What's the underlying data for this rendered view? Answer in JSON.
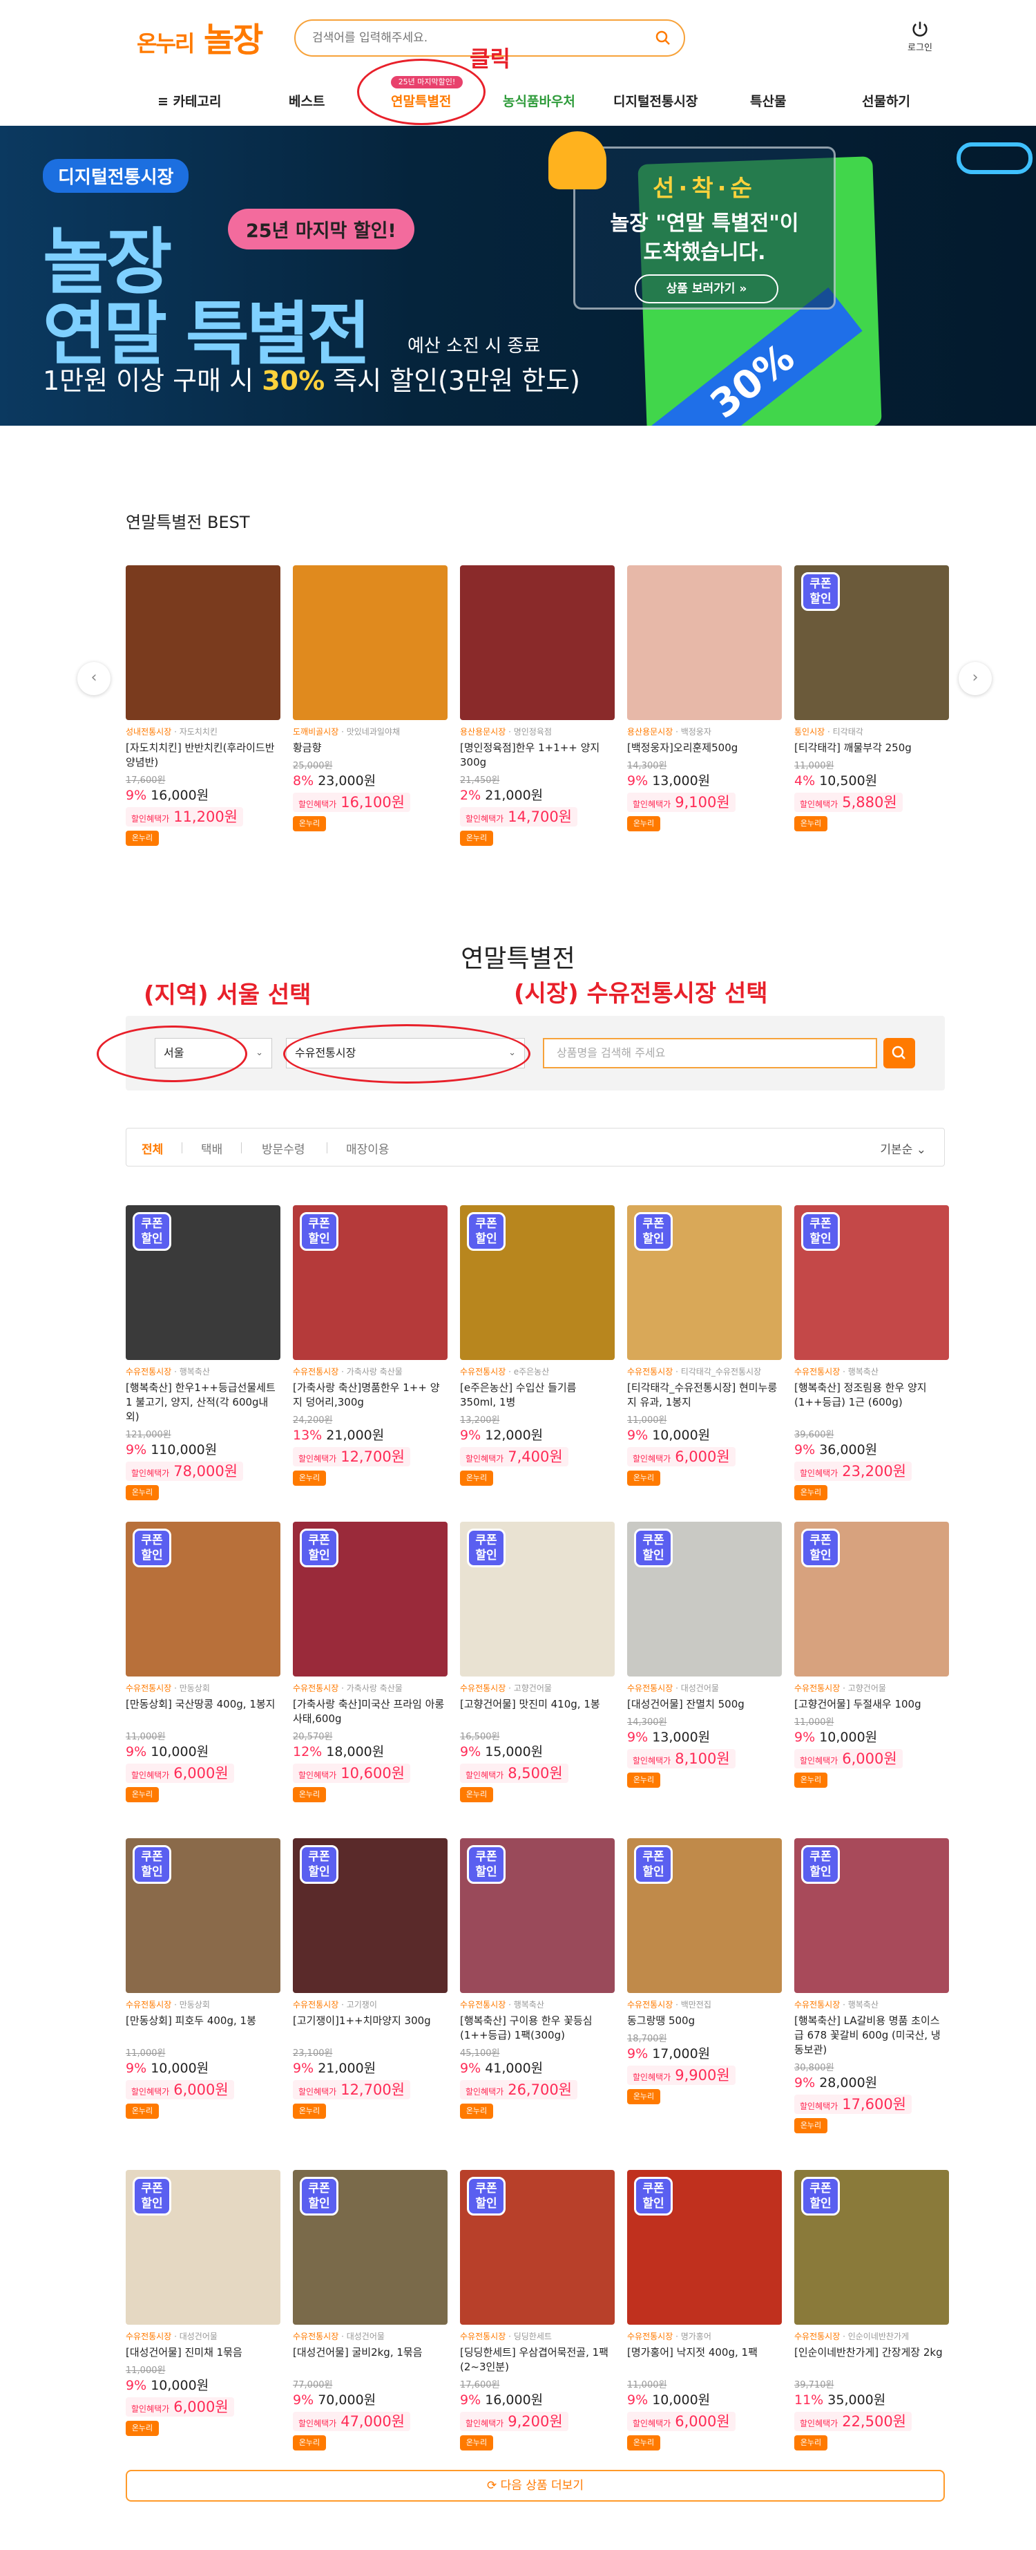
{
  "header": {
    "logo_left": "온누리",
    "logo_right": "놀장",
    "search_placeholder": "검색어를 입력해주세요.",
    "login_label": "로그인"
  },
  "nav": {
    "items": [
      "카테고리",
      "베스트",
      "연말특별전",
      "농식품바우처",
      "디지털전통시장",
      "특산물",
      "선물하기"
    ],
    "badge": "25년 마지막할인!"
  },
  "annotations": {
    "click": "클릭",
    "region": "(지역) 서울  선택",
    "market": "(시장) 수유전통시장  선택"
  },
  "banner": {
    "tag": "디지털전통시장",
    "title1": "놀장",
    "title2": "연말 특별전",
    "pill": "25년 마지막 할인!",
    "note": "예산 소진 시 종료",
    "sub_a": "1만원 이상 구매 시 ",
    "sub_b": "30%",
    "sub_c": " 즉시 할인(3만원 한도)",
    "card_top": "선·착·순",
    "card_line1": "놀장 \"연말 특별전\"이",
    "card_line2": "도착했습니다.",
    "card_btn": "상품 보러가기 »",
    "ribbon": "30%"
  },
  "best": {
    "title": "연말특별전 BEST",
    "items": [
      {
        "market": "성내전통시장",
        "shop": "자도치치킨",
        "name": "[자도치치킨] 반반치킨(후라이드반양념반)",
        "orig": "17,600원",
        "pct": "9%",
        "price": "16,000원",
        "disc": "11,200원",
        "coupon": false,
        "img": "#7a3b1e"
      },
      {
        "market": "도깨비골시장",
        "shop": "맛있네과일야채",
        "name": "황금향",
        "orig": "25,000원",
        "pct": "8%",
        "price": "23,000원",
        "disc": "16,100원",
        "coupon": false,
        "img": "#e08a1e"
      },
      {
        "market": "용산용문시장",
        "shop": "명인정육점",
        "name": "[명인정육점]한우 1+1++ 양지300g",
        "orig": "21,450원",
        "pct": "2%",
        "price": "21,000원",
        "disc": "14,700원",
        "coupon": false,
        "img": "#8a2a2a"
      },
      {
        "market": "용산용문시장",
        "shop": "백정웅자",
        "name": "[백정웅자]오리훈제500g",
        "orig": "14,300원",
        "pct": "9%",
        "price": "13,000원",
        "disc": "9,100원",
        "coupon": false,
        "img": "#e7b8a8"
      },
      {
        "market": "통인시장",
        "shop": "티각태각",
        "name": "[티각태각] 깨물부각 250g",
        "orig": "11,000원",
        "pct": "4%",
        "price": "10,500원",
        "disc": "5,880원",
        "coupon": true,
        "img": "#6b5a3a"
      }
    ]
  },
  "special": {
    "title": "연말특별전",
    "region": "서울",
    "market": "수유전통시장",
    "search_placeholder": "상품명을 검색해 주세요",
    "tabs": [
      "전체",
      "택배",
      "방문수령",
      "매장이용"
    ],
    "sort": "기본순",
    "more": "다음 상품 더보기"
  },
  "on_label": "온누리",
  "disc_label": "할인혜택가",
  "products": [
    {
      "market": "수유전통시장",
      "shop": "행복축산",
      "name": "[행복축산] 한우1++등급선물세트1 불고기, 양지, 산적(각 600g내외)",
      "orig": "121,000원",
      "pct": "9%",
      "price": "110,000원",
      "disc": "78,000원",
      "img": "#3a3a3a"
    },
    {
      "market": "수유전통시장",
      "shop": "가축사랑 축산물",
      "name": "[가축사랑 축산]명품한우 1++ 양지 덩어리,300g",
      "orig": "24,200원",
      "pct": "13%",
      "price": "21,000원",
      "disc": "12,700원",
      "img": "#b53a3a"
    },
    {
      "market": "수유전통시장",
      "shop": "e주은농산",
      "name": "[e주은농산] 수입산 들기름 350ml, 1병",
      "orig": "13,200원",
      "pct": "9%",
      "price": "12,000원",
      "disc": "7,400원",
      "img": "#b8861e"
    },
    {
      "market": "수유전통시장",
      "shop": "티각태각_수유전통시장",
      "name": "[티각태각_수유전통시장] 현미누룽지 유과, 1봉지",
      "orig": "11,000원",
      "pct": "9%",
      "price": "10,000원",
      "disc": "6,000원",
      "img": "#d9a858"
    },
    {
      "market": "수유전통시장",
      "shop": "행복축산",
      "name": "[행복축산] 정조림용 한우 양지 (1++등급) 1근 (600g)",
      "orig": "39,600원",
      "pct": "9%",
      "price": "36,000원",
      "disc": "23,200원",
      "img": "#c44848"
    },
    {
      "market": "수유전통시장",
      "shop": "만동상회",
      "name": "[만동상회] 국산땅콩 400g, 1봉지",
      "orig": "11,000원",
      "pct": "9%",
      "price": "10,000원",
      "disc": "6,000원",
      "img": "#b8703a"
    },
    {
      "market": "수유전통시장",
      "shop": "가축사랑 축산물",
      "name": "[가축사랑 축산]미국산 프라임 아롱사태,600g",
      "orig": "20,570원",
      "pct": "12%",
      "price": "18,000원",
      "disc": "10,600원",
      "img": "#9a2a3a"
    },
    {
      "market": "수유전통시장",
      "shop": "고향건어물",
      "name": "[고향건어물] 맛진미 410g, 1봉",
      "orig": "16,500원",
      "pct": "9%",
      "price": "15,000원",
      "disc": "8,500원",
      "img": "#e9e2d2"
    },
    {
      "market": "수유전통시장",
      "shop": "대성건어물",
      "name": "[대성건어물] 잔멸치 500g",
      "orig": "14,300원",
      "pct": "9%",
      "price": "13,000원",
      "disc": "8,100원",
      "img": "#c9c9c4"
    },
    {
      "market": "수유전통시장",
      "shop": "고향건어물",
      "name": "[고향건어물] 두절새우 100g",
      "orig": "11,000원",
      "pct": "9%",
      "price": "10,000원",
      "disc": "6,000원",
      "img": "#d7a27e"
    },
    {
      "market": "수유전통시장",
      "shop": "만동상회",
      "name": "[만동상회] 피호두 400g, 1봉",
      "orig": "11,000원",
      "pct": "9%",
      "price": "10,000원",
      "disc": "6,000원",
      "img": "#8a6a4a"
    },
    {
      "market": "수유전통시장",
      "shop": "고기쟁이",
      "name": "[고기쟁이]1++치마양지 300g",
      "orig": "23,100원",
      "pct": "9%",
      "price": "21,000원",
      "disc": "12,700원",
      "img": "#5a2a2a"
    },
    {
      "market": "수유전통시장",
      "shop": "행복축산",
      "name": "[행복축산] 구이용 한우 꽃등심 (1++등급) 1팩(300g)",
      "orig": "45,100원",
      "pct": "9%",
      "price": "41,000원",
      "disc": "26,700원",
      "img": "#9a4a5a"
    },
    {
      "market": "수유전통시장",
      "shop": "백만전집",
      "name": "동그랑땡 500g",
      "orig": "18,700원",
      "pct": "9%",
      "price": "17,000원",
      "disc": "9,900원",
      "img": "#c08a4a"
    },
    {
      "market": "수유전통시장",
      "shop": "행복축산",
      "name": "[행복축산] LA갈비용 명품 초이스급 678 꽃갈비 600g (미국산, 냉동보관)",
      "orig": "30,800원",
      "pct": "9%",
      "price": "28,000원",
      "disc": "17,600원",
      "img": "#a84a5a"
    },
    {
      "market": "수유전통시장",
      "shop": "대성건어물",
      "name": "[대성건어물] 진미채 1묶음",
      "orig": "11,000원",
      "pct": "9%",
      "price": "10,000원",
      "disc": "6,000원",
      "img": "#e5d8c2"
    },
    {
      "market": "수유전통시장",
      "shop": "대성건어물",
      "name": "[대성건어물] 굴비2kg, 1묶음",
      "orig": "77,000원",
      "pct": "9%",
      "price": "70,000원",
      "disc": "47,000원",
      "img": "#7a6a4a"
    },
    {
      "market": "수유전통시장",
      "shop": "딩딩한세트",
      "name": "[딩딩한세트] 우삼겹어묵전골, 1팩 (2~3인분)",
      "orig": "17,600원",
      "pct": "9%",
      "price": "16,000원",
      "disc": "9,200원",
      "img": "#b8402a"
    },
    {
      "market": "수유전통시장",
      "shop": "명가홍어",
      "name": "[명가홍어] 낙지젓 400g, 1팩",
      "orig": "11,000원",
      "pct": "9%",
      "price": "10,000원",
      "disc": "6,000원",
      "img": "#c0301e"
    },
    {
      "market": "수유전통시장",
      "shop": "인순이네반찬가게",
      "name": "[인순이네반찬가게] 간장게장 2kg",
      "orig": "39,710원",
      "pct": "11%",
      "price": "35,000원",
      "disc": "22,500원",
      "img": "#8a7a3a"
    }
  ]
}
